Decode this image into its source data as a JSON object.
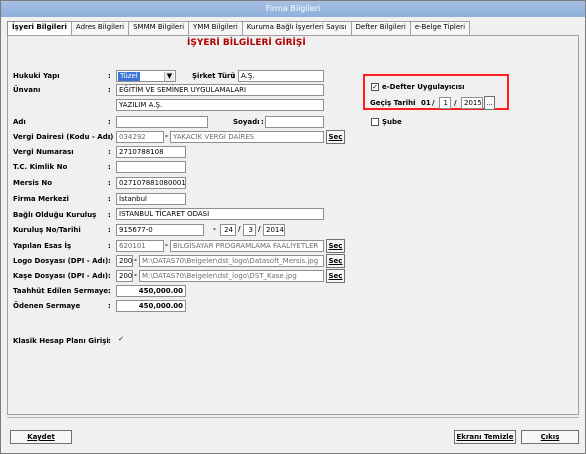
{
  "window": {
    "title": "Firma Bilgileri"
  },
  "tabs": [
    "İşyeri Bilgileri",
    "Adres Bilgileri",
    "SMMM Bilgileri",
    "YMM Bilgileri",
    "Kuruma Bağlı İşyerleri Sayısı",
    "Defter Bilgileri",
    "e-Belge Tipleri"
  ],
  "form": {
    "heading": "İŞYERİ BİLGİLERİ GİRİŞİ",
    "hukuki_yapi": {
      "label": "Hukuki Yapı",
      "value": "Tüzel"
    },
    "sirket_turu": {
      "label": "Şirket Türü",
      "value": "A.Ş."
    },
    "unvan": {
      "label": "Ünvanı",
      "line1": "EĞİTİM VE SEMİNER UYGULAMALARI",
      "line2": "YAZILIM A.Ş."
    },
    "adi": {
      "label": "Adı",
      "value": ""
    },
    "soyadi": {
      "label": "Soyadı",
      "value": ""
    },
    "vergi_dairesi": {
      "label": "Vergi Dairesi (Kodu - Adı)",
      "code": "034292",
      "name": "YAKACIK VERGİ DAİRES",
      "button": "Seç"
    },
    "vergi_numarasi": {
      "label": "Vergi Numarası",
      "value": "2710788108"
    },
    "tc_kimlik": {
      "label": "T.C. Kimlik No",
      "value": ""
    },
    "mersis": {
      "label": "Mersis No",
      "value": "0271078810800013"
    },
    "firma_merkezi": {
      "label": "Firma Merkezi",
      "value": "İstanbul"
    },
    "bagli_kurulus": {
      "label": "Bağlı Olduğu Kuruluş",
      "value": "İSTANBUL TİCARET ODASI"
    },
    "kurulus_no": {
      "label": "Kuruluş No/Tarihi",
      "value": "915677-0",
      "dash": "-",
      "day": "24",
      "month": "3",
      "year": "2014"
    },
    "yapilan_is": {
      "label": "Yapılan Esas İş",
      "code": "620101",
      "name": "BİLGİSAYAR PROGRAMLAMA FAALİYETLER",
      "button": "Seç"
    },
    "logo": {
      "label": "Logo Dosyası (DPI - Adı)",
      "dpi": "200",
      "path": "M:\\DATAS70\\Belgeler\\dst_logo\\Datasoft_Mersis.jpg",
      "button": "Seç"
    },
    "kase": {
      "label": "Kaşe Dosyası (DPI - Adı)",
      "dpi": "200",
      "path": "M:\\DATAS70\\Belgeler\\dst_logo\\DST_Kase.jpg",
      "button": "Seç"
    },
    "taahhut": {
      "label": "Taahhüt Edilen Sermaye",
      "value": "450,000.00"
    },
    "odenen": {
      "label": "Ödenen Sermaye",
      "value": "450,000.00"
    },
    "klasik": {
      "label": "Klasik Hesap Planı Girişi",
      "check": "✓"
    }
  },
  "edefter": {
    "label": "e-Defter Uygulayıcısı",
    "check": "✓",
    "gecis_label": "Geçiş Tarihi",
    "day": "01",
    "month": "1",
    "year": "2015",
    "dots": "...",
    "sube": "Şube"
  },
  "buttons": {
    "kaydet": "Kaydet",
    "ekran": "Ekranı Temizle",
    "cikis": "Çıkış"
  },
  "colors": {
    "accent": "#b00000",
    "highlight": "#ff1f1f",
    "titlebar": "#8db0dc"
  }
}
